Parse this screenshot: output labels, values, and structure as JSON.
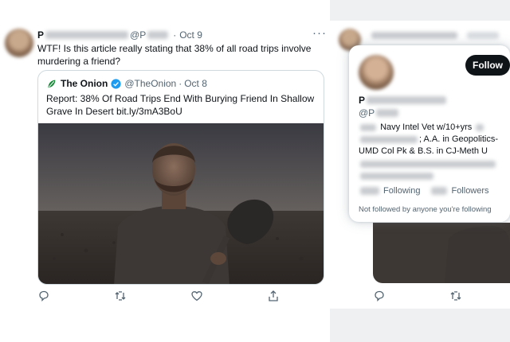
{
  "tweet": {
    "author_initial": "P",
    "handle_prefix": "@P",
    "separator": "·",
    "date": "Oct 9",
    "more": "···",
    "text": "WTF! Is this article really stating that 38% of all road trips involve murdering a friend?"
  },
  "quote": {
    "name": "The Onion",
    "handle": "@TheOnion",
    "separator": "·",
    "date": "Oct 8",
    "text": "Report: 38% Of Road Trips End With Burying Friend In Shallow Grave In Desert bit.ly/3mA3BoU",
    "brand_color": "#1a8a3a",
    "verified_color": "#1d9bf0"
  },
  "actions": {
    "icons": [
      "reply-icon",
      "retweet-icon",
      "like-icon",
      "share-icon"
    ],
    "icon_color": "#536471"
  },
  "hover_card": {
    "follow_label": "Follow",
    "name_initial": "P",
    "handle_prefix": "@P",
    "bio_line1": "Navy Intel Vet w/10+yrs",
    "bio_line2": "; A.A. in Geopolitics-",
    "bio_line3": "UMD Col Pk & B.S. in CJ-Meth U",
    "following_label": "Following",
    "followers_label": "Followers",
    "note": "Not followed by anyone you're following"
  }
}
